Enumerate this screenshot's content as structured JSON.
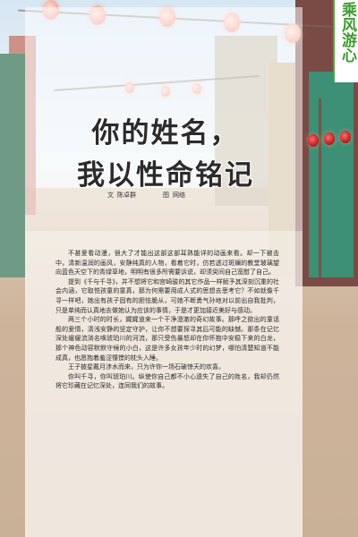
{
  "article": {
    "title_line1": "你的姓名，",
    "title_line2": "我以性命铭记",
    "byline_author_prefix": "文",
    "byline_author": "陈卓群",
    "byline_image_prefix": "图",
    "byline_image": "网络",
    "paragraphs": [
      "不甚爱看动漫，很大了才能出这部这部耳熟能详的动画来看。却一下被击中，清新温润的画风，安静纯真的人物，看着它时，仿若透过斑斓的教堂玻璃望向蓝色天空下的青绿草地，明明有很多所需要诉说，却须臾间自己宽慰了自己。",
      "提到《千与千寻》，并不想将它和宫崎骏的其它作品一样赋予其深刻沉重的社会内涵，它取悦孩童的童真，那为何需要用成人式的思想去思考它？不如就像千寻一样吧，她出有孩子固有的胆怯脆从，可她不断勇气孙地对以前出自我批判，只是单纯而认真地去做她认为应该的事情，于是才更加接近美好与感动。",
      "两三个小时的时长，娓娓道来一个干净澄澈的奇幻故事。那呼之欲出的童话般的爱情，清浅安静的坚定守护，让你不想要探寻其后可能的缺憾。那条在记忆深处缓缓流淌名唤琥珀川的河流，那只受伤暴怒却在你怀抱中安稳下来的白龙，那个神色动容默默守候的小白，这是许多女孩年少时的幻梦，哪怕清楚知道不能成真，也愿抱着羞涩憧憬的枕头入睡。",
      "王子披星戴月涉水而来，只为许你一场石破惊天的欢喜。",
      "你叫千寻，你叫琥珀川。纵使你自己都不小心遗失了自己的姓名，我却仍然将它珍藏在记忆深处，连同我们的故事。"
    ]
  },
  "column_badge": {
    "text": "乘风游心",
    "color": "#3d9b2f"
  }
}
